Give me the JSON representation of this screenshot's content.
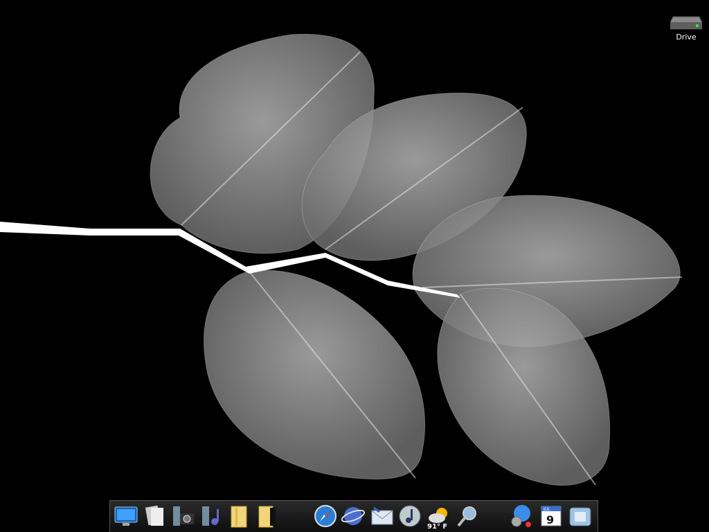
{
  "desktop": {
    "icons": [
      {
        "label": "Drive",
        "icon": "hard-drive-icon"
      }
    ],
    "wallpaper": "x-ray-leaves"
  },
  "dock": {
    "items": [
      {
        "icon": "monitor-desktop-icon"
      },
      {
        "icon": "document-stack-icon"
      },
      {
        "icon": "camera-stack-icon"
      },
      {
        "icon": "music-stack-icon"
      },
      {
        "icon": "folder-icon"
      },
      {
        "icon": "folder-dark-icon"
      },
      {
        "icon": "safari-compass-icon"
      },
      {
        "icon": "network-globe-icon"
      },
      {
        "icon": "mail-icon"
      },
      {
        "icon": "itunes-icon"
      },
      {
        "icon": "weather-icon",
        "temperature": "91° F"
      },
      {
        "icon": "spotlight-magnifier-icon"
      },
      {
        "icon": "system-preferences-icon"
      },
      {
        "icon": "calendar-icon",
        "day": "9",
        "month": "JUL"
      },
      {
        "icon": "finder-icon"
      }
    ]
  },
  "colors": {
    "background": "#000000",
    "leaf": "#9a9a9a",
    "stem": "#ffffff"
  }
}
